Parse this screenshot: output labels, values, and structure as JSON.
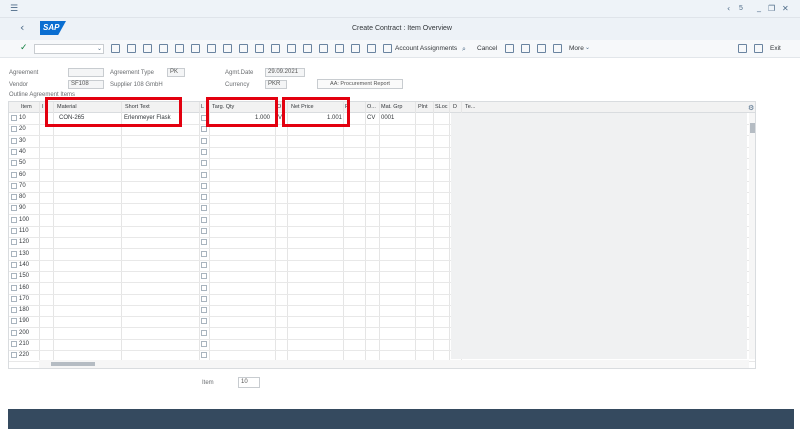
{
  "app": {
    "title": "Create Contract : Item Overview",
    "logo_text": "SAP"
  },
  "topbar": {
    "page_label": "5"
  },
  "toolbar": {
    "account_assignments_label": "Account Assignments",
    "cancel_label": "Cancel",
    "more_label": "More",
    "exit_label": "Exit"
  },
  "header": {
    "agreement_label": "Agreement",
    "agreement_value": "",
    "agreement_type_label": "Agreement Type",
    "agreement_type_value": "PK",
    "agmt_date_label": "Agmt.Date",
    "agmt_date_value": "29.09.2021",
    "vendor_label": "Vendor",
    "vendor_value": "SF108",
    "vendor_name": "Supplier 108 GmbH",
    "currency_label": "Currency",
    "currency_value": "PKR",
    "procurement_report_label": "AA: Procurement Report",
    "outline_label": "Outline Agreement Items"
  },
  "table": {
    "columns": [
      "Item",
      "I",
      "Material",
      "Short Text",
      "L",
      "Targ. Qty",
      "O",
      "Net Price",
      "P",
      "O...",
      "Mat. Grp",
      "Plnt",
      "SLoc",
      "D",
      "Te..."
    ],
    "first_row": {
      "item": "10",
      "material": "CON-265",
      "short_text": "Erlenmeyer Flask",
      "targ_qty": "1.000",
      "unit": "V",
      "net_price": "1.001",
      "o_col": "CV",
      "mat_grp": "0001"
    },
    "items": [
      "10",
      "20",
      "30",
      "40",
      "50",
      "60",
      "70",
      "80",
      "90",
      "100",
      "110",
      "120",
      "130",
      "140",
      "150",
      "160",
      "170",
      "180",
      "190",
      "200",
      "210",
      "220"
    ]
  },
  "footer_item": {
    "label": "Item",
    "value": "10"
  }
}
